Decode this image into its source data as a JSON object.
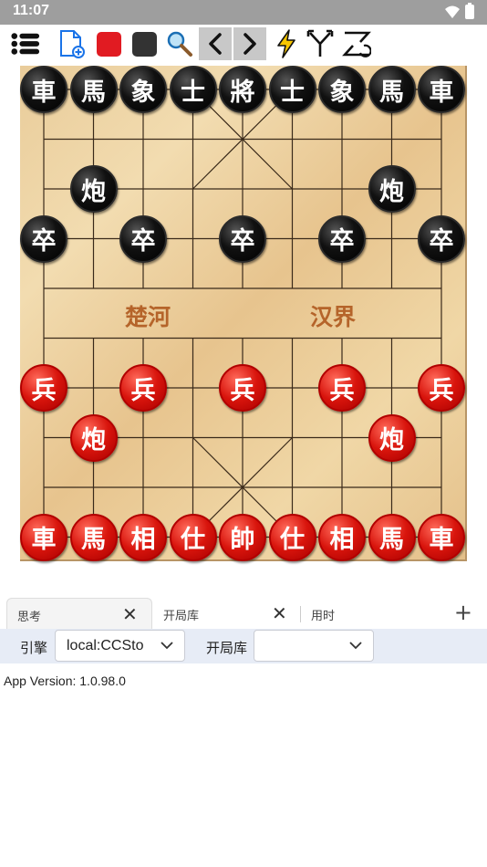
{
  "status_bar": {
    "time": "11:07"
  },
  "toolbar": {
    "icons": [
      "menu-icon",
      "new-file-icon",
      "red-square-icon",
      "black-square-icon",
      "search-icon",
      "prev-icon",
      "next-icon",
      "lightning-icon",
      "branch-icon",
      "flip-icon"
    ]
  },
  "board": {
    "river_left": "楚河",
    "river_right": "汉界",
    "black_back": [
      "車",
      "馬",
      "象",
      "士",
      "將",
      "士",
      "象",
      "馬",
      "車"
    ],
    "black_cannon": "炮",
    "black_soldier": "卒",
    "red_back": [
      "車",
      "馬",
      "相",
      "仕",
      "帥",
      "仕",
      "相",
      "馬",
      "車"
    ],
    "red_cannon": "炮",
    "red_soldier": "兵"
  },
  "tabs": {
    "items": [
      {
        "label": "思考"
      },
      {
        "label": "开局库"
      },
      {
        "label": "用时"
      }
    ],
    "add_label": "+"
  },
  "engine_row": {
    "engine_label": "引擎",
    "engine_value": "local:CCSto",
    "book_label": "开局库",
    "book_value": ""
  },
  "footer": {
    "version": "App Version: 1.0.98.0"
  },
  "colors": {
    "red_piece": "#d8140c",
    "black_piece": "#111111",
    "board": "#ecd3a3",
    "river_text": "#b5642a"
  }
}
